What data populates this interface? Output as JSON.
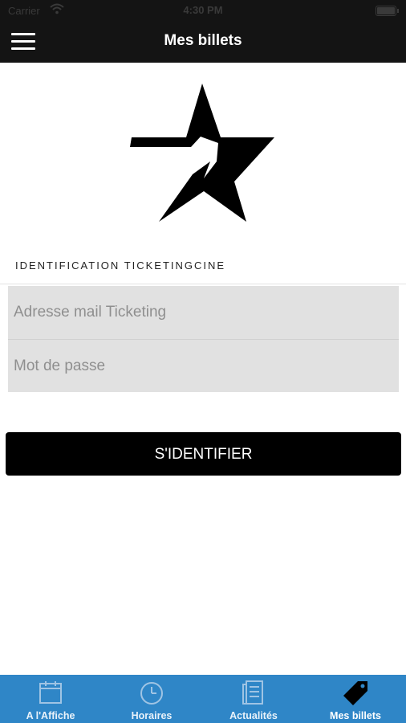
{
  "status_bar": {
    "carrier": "Carrier",
    "time": "4:30 PM"
  },
  "header": {
    "title": "Mes billets"
  },
  "login": {
    "section_label": "IDENTIFICATION TICKETINGCINE",
    "email_placeholder": "Adresse mail Ticketing",
    "password_placeholder": "Mot de passe",
    "submit_label": "S'IDENTIFIER"
  },
  "tabs": [
    {
      "label": "A l'Affiche",
      "icon": "calendar-icon"
    },
    {
      "label": "Horaires",
      "icon": "clock-icon"
    },
    {
      "label": "Actualités",
      "icon": "news-icon"
    },
    {
      "label": "Mes billets",
      "icon": "ticket-tag-icon",
      "active": true
    }
  ],
  "colors": {
    "header_bg": "#141414",
    "tab_bar": "#2f86c7",
    "field_bg": "#e1e1e1",
    "button_bg": "#000000"
  }
}
